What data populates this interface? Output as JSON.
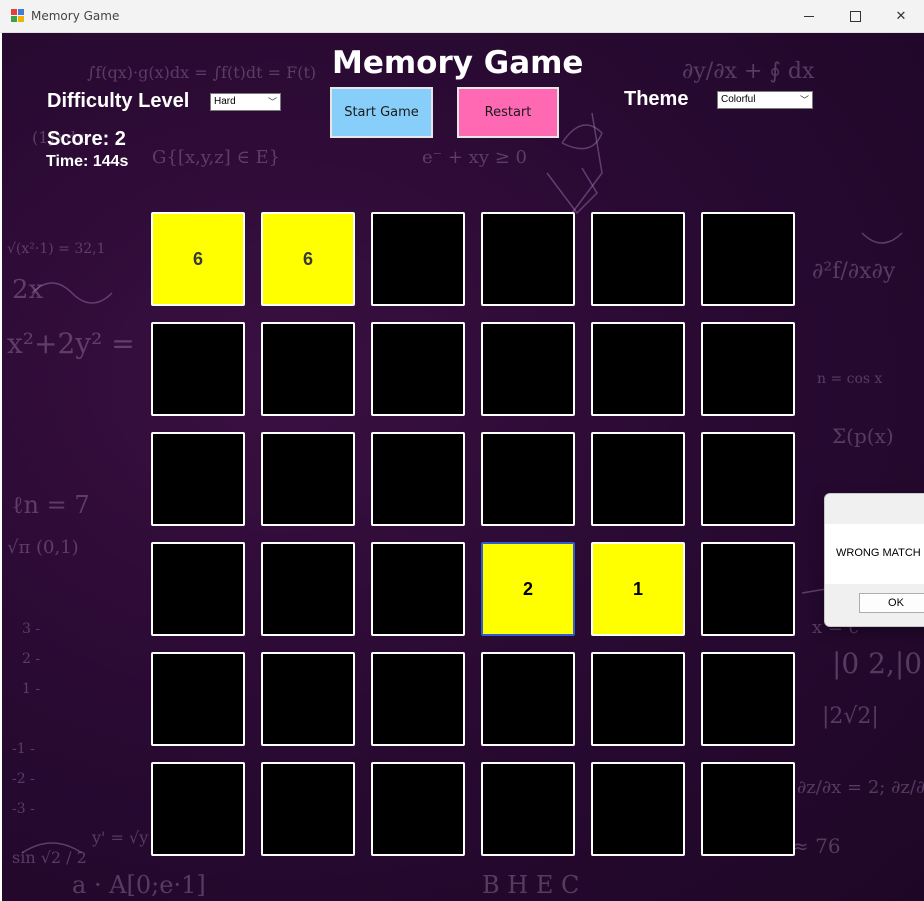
{
  "window": {
    "title": "Memory Game",
    "controls": [
      "minimize-icon",
      "maximize-icon",
      "close-icon"
    ]
  },
  "header": {
    "title": "Memory Game",
    "difficulty_label": "Difficulty Level",
    "difficulty_value": "Hard",
    "theme_label": "Theme",
    "theme_value": "Colorful",
    "start_button": "Start Game",
    "restart_button": "Restart"
  },
  "status": {
    "score": "Score: 2",
    "time": "Time: 144s"
  },
  "board": {
    "rows": 6,
    "cols": 6,
    "revealed_color": "#ffff00",
    "hidden_color": "#000000",
    "revealed": [
      {
        "row": 0,
        "col": 0,
        "value": "6",
        "matched": true
      },
      {
        "row": 0,
        "col": 1,
        "value": "6",
        "matched": true
      },
      {
        "row": 3,
        "col": 3,
        "value": "2",
        "matched": false
      },
      {
        "row": 3,
        "col": 4,
        "value": "1",
        "matched": false
      }
    ]
  },
  "dialog": {
    "message": "WRONG MATCH",
    "ok_label": "OK"
  },
  "colors": {
    "start_button": "#87cefa",
    "restart_button": "#ff69b4",
    "background": "#2a0a33"
  }
}
